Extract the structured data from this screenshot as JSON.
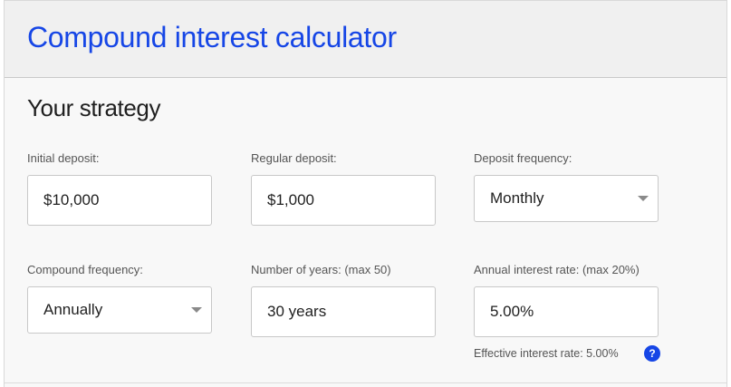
{
  "header": {
    "title": "Compound interest calculator"
  },
  "strategy": {
    "title": "Your strategy",
    "initial_deposit": {
      "label": "Initial deposit:",
      "value": "$10,000"
    },
    "regular_deposit": {
      "label": "Regular deposit:",
      "value": "$1,000"
    },
    "deposit_frequency": {
      "label": "Deposit frequency:",
      "value": "Monthly"
    },
    "compound_frequency": {
      "label": "Compound frequency:",
      "value": "Annually"
    },
    "years": {
      "label": "Number of years: (max 50)",
      "value": "30 years"
    },
    "interest_rate": {
      "label": "Annual interest rate: (max 20%)",
      "value": "5.00%"
    },
    "effective_rate_text": "Effective interest rate: 5.00%",
    "help_icon": {
      "name": "help-icon",
      "glyph": "?"
    }
  },
  "colors": {
    "accent": "#1646e6",
    "header_bg": "#f0f0f0",
    "card_bg": "#f8f8f8"
  }
}
